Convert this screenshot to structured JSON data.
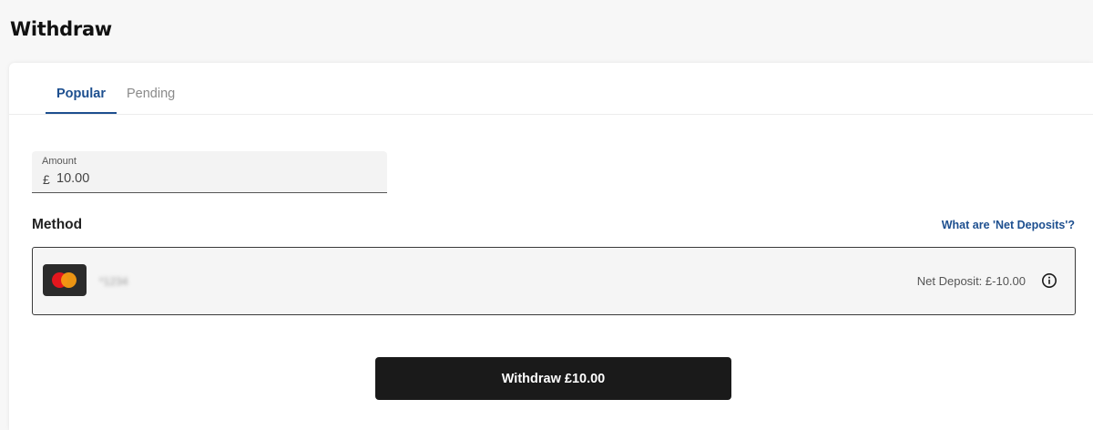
{
  "page": {
    "title": "Withdraw"
  },
  "tabs": [
    {
      "label": "Popular",
      "active": true
    },
    {
      "label": "Pending",
      "active": false
    }
  ],
  "amount": {
    "label": "Amount",
    "currency": "£",
    "value": "10.00"
  },
  "method": {
    "heading": "Method",
    "help_link": "What are 'Net Deposits'?",
    "selected": {
      "card_icon": "mastercard-icon",
      "masked_number": "*1234",
      "net_deposit": "Net Deposit: £-10.00",
      "info_icon": "info-circle-icon"
    }
  },
  "actions": {
    "withdraw_label": "Withdraw £10.00"
  },
  "colors": {
    "accent": "#1d4f8f",
    "button_bg": "#1a1a1a",
    "mastercard_red": "#e3161d",
    "mastercard_orange": "#f59a12"
  }
}
